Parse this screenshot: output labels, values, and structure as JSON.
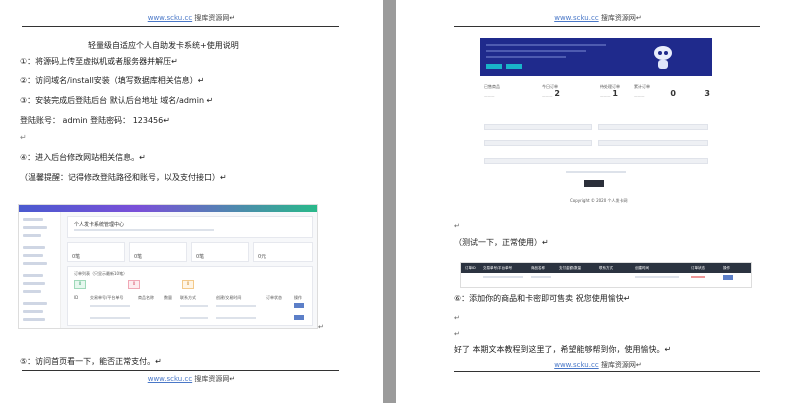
{
  "header": {
    "site": "www.scku.cc",
    "label": "搜库资源网",
    "mark": "↵"
  },
  "footer": {
    "site": "www.scku.cc",
    "label": "搜库资源网",
    "mark": "↵"
  },
  "left_page": {
    "title": "轻量级自适应个人自助发卡系统+使用说明",
    "lines": [
      "①：将源码上传至虚拟机或者服务器并解压↵",
      "②：访问域名/install安装（填写数据库相关信息）↵",
      "③：安装完成后登陆后台 默认后台地址 域名/admin ↵",
      "登陆账号： admin 登陆密码： 123456↵",
      "↵",
      "④：进入后台修改网站相关信息。↵",
      "（温馨提醒：记得修改登陆路径和账号，以及支付接口）↵"
    ],
    "step5": "⑤：访问首页看一下，能否正常支付。↵",
    "embedded": {
      "welcome": "个人发卡系统管理中心",
      "stats": [
        "0笔",
        "0笔",
        "0笔",
        "0元"
      ],
      "section": "订单列表（只显示最新10笔）",
      "tiles": [
        "0",
        "0",
        "0"
      ],
      "columns": [
        "ID",
        "交易单号/平台单号",
        "商品名称",
        "数量",
        "联系方式",
        "创建/交易时间",
        "订单状态",
        "操作"
      ]
    }
  },
  "right_page": {
    "test_note": "（测试一下，正常使用）↵",
    "step6": "⑥：添加你的商品和卡密即可售卖  祝您使用愉快↵",
    "closing": "好了 本期文本教程到这里了，希望能够帮到你，使用愉快。↵",
    "stats": [
      {
        "label": "已售商品",
        "value": "2"
      },
      {
        "label": "今日订单",
        "value": "1"
      },
      {
        "label": "待处理订单",
        "value": "0"
      },
      {
        "label": "累计订单",
        "value": "3"
      }
    ],
    "copyright": "Copyright © 2020 个人发卡网",
    "table_columns": [
      "订单ID",
      "交易单号/平台单号",
      "商品名称",
      "支付金额/数量",
      "联系方式",
      "创建时间",
      "订单状态",
      "操作"
    ]
  },
  "colors": {
    "accent": "#1f2a8c",
    "link": "#4a78c8",
    "gutter": "#9b9b9b"
  }
}
